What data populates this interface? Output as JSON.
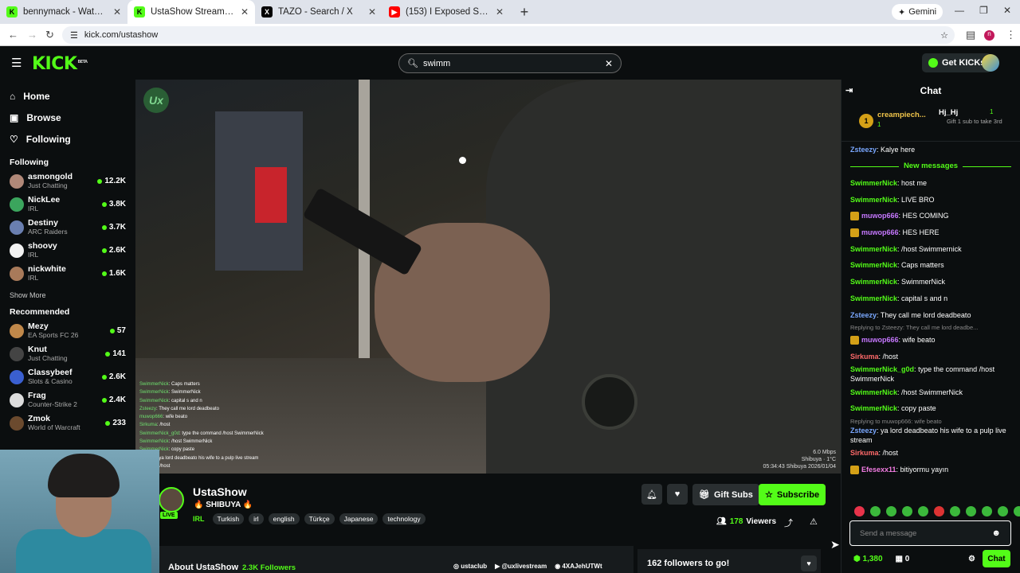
{
  "browser": {
    "tabs": [
      {
        "title": "bennymack - Watch the VOD o",
        "favicon": "K",
        "color": "#53fc18"
      },
      {
        "title": "UstaShow Stream - Watch L",
        "favicon": "K",
        "color": "#53fc18",
        "active": true
      },
      {
        "title": "TAZO - Search / X",
        "favicon": "X",
        "color": "#000000"
      },
      {
        "title": "(153) I Exposed Scammers in To",
        "favicon": "▶",
        "color": "#ff0000"
      }
    ],
    "gemini_label": "Gemini",
    "url": "kick.com/ustashow"
  },
  "header": {
    "logo": "KICK",
    "logo_beta": "BETA",
    "search_value": "swimm",
    "get_kicks": "Get KICKs"
  },
  "sidebar": {
    "nav": [
      "Home",
      "Browse",
      "Following"
    ],
    "following_title": "Following",
    "following": [
      {
        "name": "asmongold",
        "category": "Just Chatting",
        "viewers": "12.2K",
        "color": "#b08878"
      },
      {
        "name": "NickLee",
        "category": "IRL",
        "viewers": "3.8K",
        "color": "#3ba55d"
      },
      {
        "name": "Destiny",
        "category": "ARC Raiders",
        "viewers": "3.7K",
        "color": "#6a7fb0"
      },
      {
        "name": "shoovy",
        "category": "IRL",
        "viewers": "2.6K",
        "color": "#f2f2f2"
      },
      {
        "name": "nickwhite",
        "category": "IRL",
        "viewers": "1.6K",
        "color": "#a87a5a"
      }
    ],
    "show_more": "Show More",
    "recommended_title": "Recommended",
    "recommended": [
      {
        "name": "Mezy",
        "category": "EA Sports FC 26",
        "viewers": "57",
        "color": "#c0884a"
      },
      {
        "name": "Knut",
        "category": "Just Chatting",
        "viewers": "141",
        "color": "#444444"
      },
      {
        "name": "Classybeef",
        "category": "Slots & Casino",
        "viewers": "2.6K",
        "color": "#3a5fd0"
      },
      {
        "name": "Frag",
        "category": "Counter-Strike 2",
        "viewers": "2.4K",
        "color": "#dddddd"
      },
      {
        "name": "Zmok",
        "category": "World of Warcraft",
        "viewers": "233",
        "color": "#6b4a2e"
      }
    ]
  },
  "video": {
    "badge": "Ux",
    "overlay_chat": [
      {
        "user": "SwimmerNick",
        "text": "Caps matters"
      },
      {
        "user": "SwimmerNick",
        "text": "SwimmerNick"
      },
      {
        "user": "SwimmerNick",
        "text": "capital s and n"
      },
      {
        "user": "Zsteezy",
        "text": "They call me lord deadbeato"
      },
      {
        "user": "muwop666",
        "text": "wife beato"
      },
      {
        "user": "Sirkuma",
        "text": "/host"
      },
      {
        "user": "SwimmerNick_g0d",
        "text": "type the command /host SwimmerNick"
      },
      {
        "user": "SwimmerNick",
        "text": "/host SwimmerNick"
      },
      {
        "user": "SwimmerNick",
        "text": "copy paste"
      },
      {
        "user": "Zsteezy",
        "text": "ya lord deadbeato his wife to a pulp live stream"
      },
      {
        "user": "Sirkuma",
        "text": "/host"
      }
    ],
    "stats_line1": "6.0 Mbps",
    "stats_line2": "Shibuya · 1°C",
    "stats_line3": "05:34:43 Shibuya 2026/01/04"
  },
  "stream": {
    "channel": "UstaShow",
    "title": "🔥 SHIBUYA 🔥",
    "live": "LIVE",
    "category": "IRL",
    "tags": [
      "Turkish",
      "irl",
      "english",
      "Türkçe",
      "Japanese",
      "technology"
    ],
    "gift_subs": "Gift Subs",
    "subscribe": "Subscribe",
    "viewers_count": "178",
    "viewers_label": "Viewers",
    "about": "About UstaShow",
    "followers": "2.3K Followers",
    "socials": [
      "ustaclub",
      "@uxlivestream",
      "4XAJehUTWt"
    ],
    "goal": "162 followers to go!"
  },
  "chat": {
    "title": "Chat",
    "pinned": [
      {
        "rank": "1",
        "name": "creampiech...",
        "count": "1"
      },
      {
        "name": "Hj_Hj",
        "count": "1",
        "sub": "Gift 1 sub to take 3rd"
      }
    ],
    "messages": [
      {
        "user": "Zsteezy",
        "text": "Kalye here",
        "cls": "b"
      },
      {
        "divider": "New messages"
      },
      {
        "user": "SwimmerNick",
        "text": "host me"
      },
      {
        "user": "SwimmerNick",
        "text": "LIVE BRO"
      },
      {
        "user": "muwop666",
        "text": "HES COMING",
        "cls": "p",
        "badge": true
      },
      {
        "user": "muwop666",
        "text": "HES HERE",
        "cls": "p",
        "badge": true
      },
      {
        "user": "SwimmerNick",
        "text": "/host Swimmernick"
      },
      {
        "user": "SwimmerNick",
        "text": "Caps matters"
      },
      {
        "user": "SwimmerNick",
        "text": "SwimmerNick"
      },
      {
        "user": "SwimmerNick",
        "text": "capital s and n"
      },
      {
        "user": "Zsteezy",
        "text": "They call me lord deadbeato",
        "cls": "b"
      },
      {
        "reply": "Replying to Zsteezy: They call me lord deadbe..."
      },
      {
        "user": "muwop666",
        "text": "wife beato",
        "cls": "p",
        "badge": true
      },
      {
        "user": "Sirkuma",
        "text": "/host",
        "cls": "r"
      },
      {
        "user": "SwimmerNick_g0d",
        "text": "type the command /host SwimmerNick"
      },
      {
        "user": "SwimmerNick",
        "text": "/host SwimmerNick"
      },
      {
        "user": "SwimmerNick",
        "text": "copy paste"
      },
      {
        "reply": "Replying to muwop666: wife beato"
      },
      {
        "user": "Zsteezy",
        "text": "ya lord deadbeato his wife to a pulp live stream",
        "cls": "b"
      },
      {
        "user": "Sirkuma",
        "text": "/host",
        "cls": "r"
      },
      {
        "user": "Efesexx11",
        "text": "bitiyormu yayın",
        "cls": "o",
        "badge": true
      }
    ],
    "input_placeholder": "Send a message",
    "kicks_balance": "1,380",
    "points": "0",
    "chat_button": "Chat"
  }
}
